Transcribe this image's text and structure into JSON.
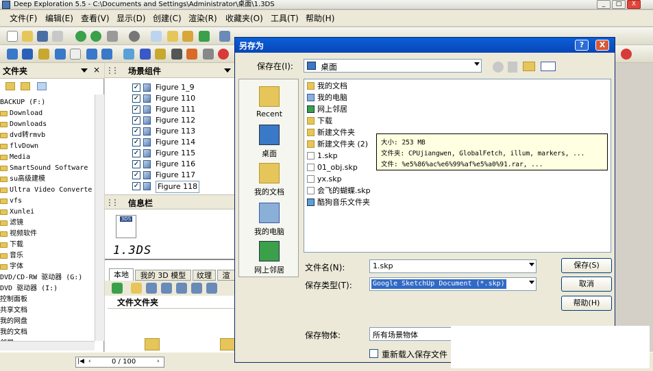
{
  "window": {
    "title": "Deep Exploration 5.5 - C:\\Documents and Settings\\Administrator\\桌面\\1.3DS",
    "minimize_label": "_",
    "maximize_label": "□",
    "close_label": "X"
  },
  "menu": [
    "文件(F)",
    "编辑(E)",
    "查看(V)",
    "显示(D)",
    "创建(C)",
    "渲染(R)",
    "收藏夹(O)",
    "工具(T)",
    "帮助(H)"
  ],
  "folder_panel": {
    "title": "文件夹",
    "items": [
      "BACKUP (F:)",
      "Download",
      "Downloads",
      "dvd转rmvb",
      "flvDown",
      "Media",
      "SmartSound Software",
      "su高级建模",
      "Ultra Video Converte",
      "vfs",
      "Xunlei",
      "滤镜",
      "视频软件",
      "下载",
      "音乐",
      "字体",
      "DVD/CD-RW 驱动器 (G:)",
      "DVD 驱动器 (I:)",
      "控制面板",
      "共享文档",
      "我的网盘",
      "我的文档",
      "邻居"
    ]
  },
  "scene_panel": {
    "title": "场景组件",
    "figures": [
      "Figure 1_9",
      "Figure 110",
      "Figure 111",
      "Figure 112",
      "Figure 113",
      "Figure 114",
      "Figure 115",
      "Figure 116",
      "Figure 117",
      "Figure 118"
    ]
  },
  "info_panel": {
    "title": "信息栏",
    "thumb_label": "3DS",
    "file_caption": "1.3DS"
  },
  "bottom_tabs": [
    "本地",
    "我的 3D 模型",
    "纹理",
    "渲"
  ],
  "files_header": "文件文件夹",
  "status": {
    "page_counter": "0 / 100"
  },
  "dialog": {
    "title": "另存为",
    "help_label": "?",
    "close_label": "X",
    "save_in_label": "保存在(I):",
    "save_in_value": "桌面",
    "places": [
      "Recent",
      "桌面",
      "我的文档",
      "我的电脑",
      "网上邻居"
    ],
    "files": [
      "我的文档",
      "我的电脑",
      "网上邻居",
      "下载",
      "新建文件夹",
      "新建文件夹 (2)",
      "1.skp",
      "01_obj.skp",
      "yx.skp",
      "会飞的蝴蝶.skp",
      "酷狗音乐文件夹"
    ],
    "tooltip": {
      "line1": "大小: 253 MB",
      "line2": "文件夹: CPUjiangwen, GlobalFetch, illum, markers, ...",
      "line3": "文件: %e5%86%ac%e6%99%af%e5%a0%91.rar, ..."
    },
    "filename_label": "文件名(N):",
    "filename_value": "1.skp",
    "filetype_label": "保存类型(T):",
    "filetype_value": "Google SketchUp Document (*.skp)",
    "save_button": "保存(S)",
    "cancel_button": "取消",
    "help_button": "帮助(H)",
    "save_object_label": "保存物体:",
    "save_object_value": "所有场景物体",
    "reload_checkbox_label": "重新载入保存文件"
  }
}
